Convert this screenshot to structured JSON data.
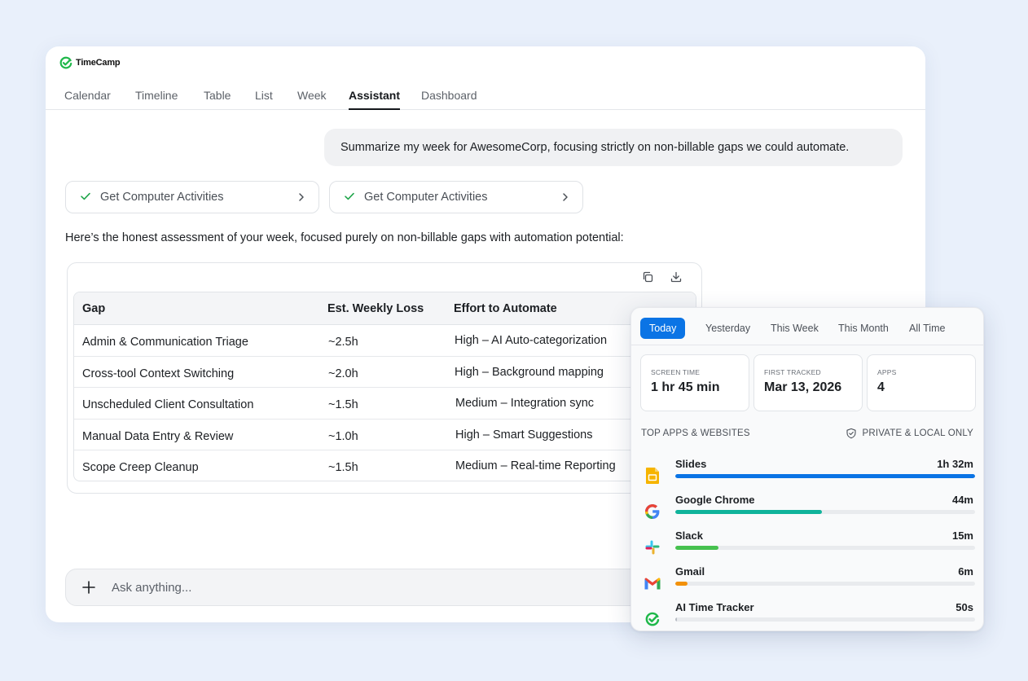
{
  "app": {
    "brand": "TimeCamp"
  },
  "tabs": [
    {
      "label": "Calendar"
    },
    {
      "label": "Timeline"
    },
    {
      "label": "Table"
    },
    {
      "label": "List"
    },
    {
      "label": "Week"
    },
    {
      "label": "Assistant",
      "active": true
    },
    {
      "label": "Dashboard"
    }
  ],
  "chat": {
    "user_message": "Summarize my week for AwesomeCorp, focusing strictly on non-billable gaps we could automate.",
    "tool_calls": [
      {
        "label": "Get Computer Activities",
        "status": "done"
      },
      {
        "label": "Get Computer Activities",
        "status": "done"
      }
    ],
    "assistant_intro": "Here’s the honest assessment of your week, focused purely on non-billable gaps with automation potential:",
    "table": {
      "headers": [
        "Gap",
        "Est. Weekly Loss",
        "Effort to Automate"
      ],
      "rows": [
        [
          "Admin & Communication Triage",
          "~2.5h",
          "High – AI Auto-categorization"
        ],
        [
          "Cross-tool Context Switching",
          "~2.0h",
          "High – Background mapping"
        ],
        [
          "Unscheduled Client Consultation",
          "~1.5h",
          "Medium – Integration sync"
        ],
        [
          "Manual Data Entry & Review",
          "~1.0h",
          "High – Smart Suggestions"
        ],
        [
          "Scope Creep Cleanup",
          "~1.5h",
          "Medium – Real-time Reporting"
        ]
      ]
    },
    "input": {
      "placeholder": "Ask anything..."
    }
  },
  "activity": {
    "ranges": [
      {
        "label": "Today",
        "active": true
      },
      {
        "label": "Yesterday"
      },
      {
        "label": "This Week"
      },
      {
        "label": "This Month"
      },
      {
        "label": "All Time"
      }
    ],
    "stats": [
      {
        "label": "SCREEN TIME",
        "value": "1 hr 45 min"
      },
      {
        "label": "FIRST TRACKED",
        "value": "Mar 13, 2026"
      },
      {
        "label": "APPS",
        "value": "4"
      }
    ],
    "section_title": "TOP APPS & WEBSITES",
    "privacy_note": "PRIVATE & LOCAL ONLY",
    "apps": [
      {
        "name": "Slides",
        "time": "1h 32m",
        "share": 1.0,
        "color": "#0b74e5",
        "icon": "google-slides-icon"
      },
      {
        "name": "Google Chrome",
        "time": "44m",
        "share": 0.49,
        "color": "#10b39b",
        "icon": "google-chrome-icon"
      },
      {
        "name": "Slack",
        "time": "15m",
        "share": 0.145,
        "color": "#46c14f",
        "icon": "slack-icon"
      },
      {
        "name": "Gmail",
        "time": "6m",
        "share": 0.04,
        "color": "#f2910a",
        "icon": "gmail-icon"
      },
      {
        "name": "AI Time Tracker",
        "time": "50s",
        "share": 0.006,
        "color": "#b7bcc3",
        "icon": "timecamp-icon"
      }
    ]
  },
  "colors": {
    "accent": "#0b74e5",
    "brand_green": "#1fb84a",
    "background": "#e9f0fb"
  }
}
